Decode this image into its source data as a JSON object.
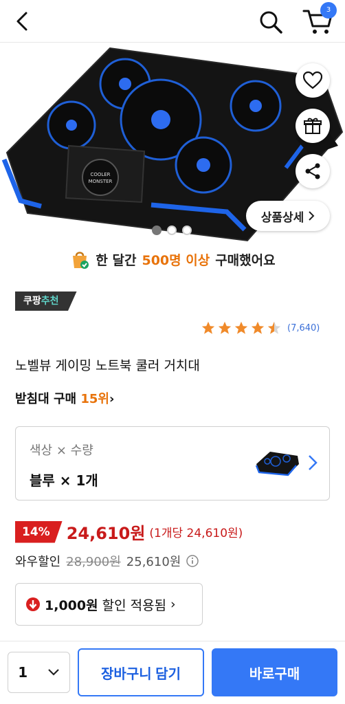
{
  "header": {
    "cart_count": "3"
  },
  "hero": {
    "detail_label": "상품상세",
    "image_text_line1": "COOLER",
    "image_text_line2": "MONSTER"
  },
  "social_proof": {
    "prefix": "한 달간",
    "highlight": "500명 이상",
    "suffix": "구매했어요"
  },
  "badge": {
    "part1": "쿠팡",
    "part2": "추천"
  },
  "rating": {
    "stars": 4.5,
    "count": "(7,640)"
  },
  "product": {
    "title": "노벨뷰 게이밍 노트북 쿨러 거치대",
    "rank_prefix": "받침대 구매",
    "rank_value": "15위"
  },
  "option": {
    "label": "색상 × 수량",
    "value": "블루 × 1개"
  },
  "price": {
    "discount": "14%",
    "sale_price": "24,610원",
    "unit_price": "(1개당 24,610원)",
    "wow_label": "와우할인",
    "original_price": "28,900원",
    "alt_price": "25,610원"
  },
  "coupon": {
    "amount": "1,000원",
    "text": "할인 적용됨"
  },
  "bottom": {
    "quantity": "1",
    "add_to_cart": "장바구니 담기",
    "buy_now": "바로구매"
  },
  "colors": {
    "accent": "#3478f6",
    "price_red": "#c81a1a",
    "orange": "#e8730b"
  }
}
